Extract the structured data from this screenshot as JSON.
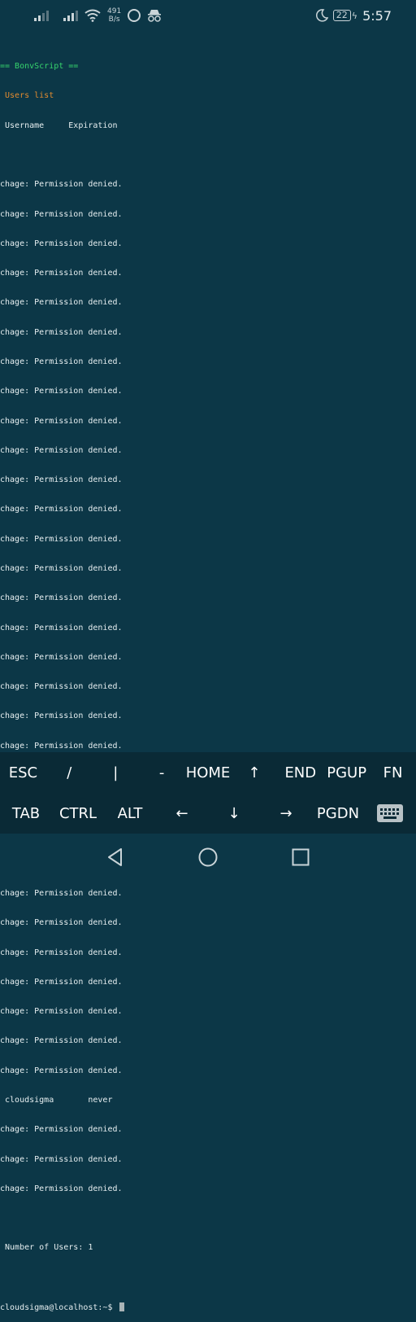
{
  "status_bar": {
    "net_speed_value": "491",
    "net_speed_unit": "B/s",
    "battery": "22",
    "time": "5:57",
    "icons": [
      "signal-icon",
      "signal-icon",
      "wifi-icon",
      "app-notification-icon",
      "incognito-icon",
      "moon-icon",
      "battery-icon",
      "charging-icon"
    ]
  },
  "terminal": {
    "header": "== BonvScript ==",
    "subheader": " Users list",
    "columns": " Username     Expiration",
    "denied_line": "chage: Permission denied.",
    "user_row": " cloudsigma       never",
    "count_line": " Number of Users: 1",
    "prompt": "cloudsigma@localhost:~$ ",
    "colors": {
      "header": "#36d36c",
      "subheader": "#e38b2f",
      "text": "#e6eef0",
      "background": "#0c3747"
    }
  },
  "extra_keys": {
    "row1": [
      "ESC",
      "/",
      "|",
      "-",
      "HOME",
      "↑",
      "END",
      "PGUP",
      "FN"
    ],
    "row2": [
      "TAB",
      "CTRL",
      "ALT",
      "←",
      "↓",
      "→",
      "PGDN"
    ],
    "keyboard_icon": "keyboard-icon"
  },
  "nav_bar": {
    "icons": [
      "back-icon",
      "home-icon",
      "recents-icon"
    ]
  }
}
